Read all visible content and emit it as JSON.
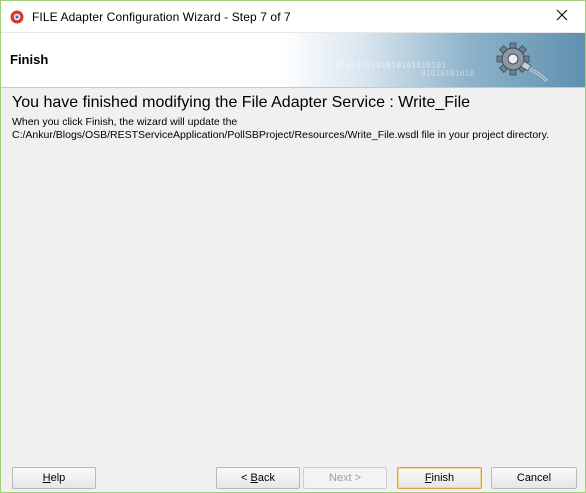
{
  "window": {
    "title": "FILE Adapter Configuration Wizard - Step 7 of 7"
  },
  "banner": {
    "title": "Finish",
    "binary_text_1": "0101010101010101010101",
    "binary_text_2": "01010101010"
  },
  "content": {
    "heading": "You have finished modifying the File Adapter Service : Write_File",
    "line1": "When you click Finish, the wizard will update the",
    "line2": "C:/Ankur/Blogs/OSB/RESTServiceApplication/PollSBProject/Resources/Write_File.wsdl file in your project directory."
  },
  "buttons": {
    "help": {
      "mnemonic": "H",
      "rest": "elp"
    },
    "back": {
      "prefix": "< ",
      "mnemonic": "B",
      "rest": "ack"
    },
    "next": "Next >",
    "finish": {
      "mnemonic": "F",
      "rest": "inish"
    },
    "cancel": "Cancel"
  },
  "icons": {
    "app": "oracle-app-icon",
    "close": "close-icon",
    "banner": "gear-plug-icon"
  },
  "colors": {
    "window_border": "#9fcf7a",
    "banner_accent": "#5f90b0",
    "default_button_border": "#e0a040"
  }
}
